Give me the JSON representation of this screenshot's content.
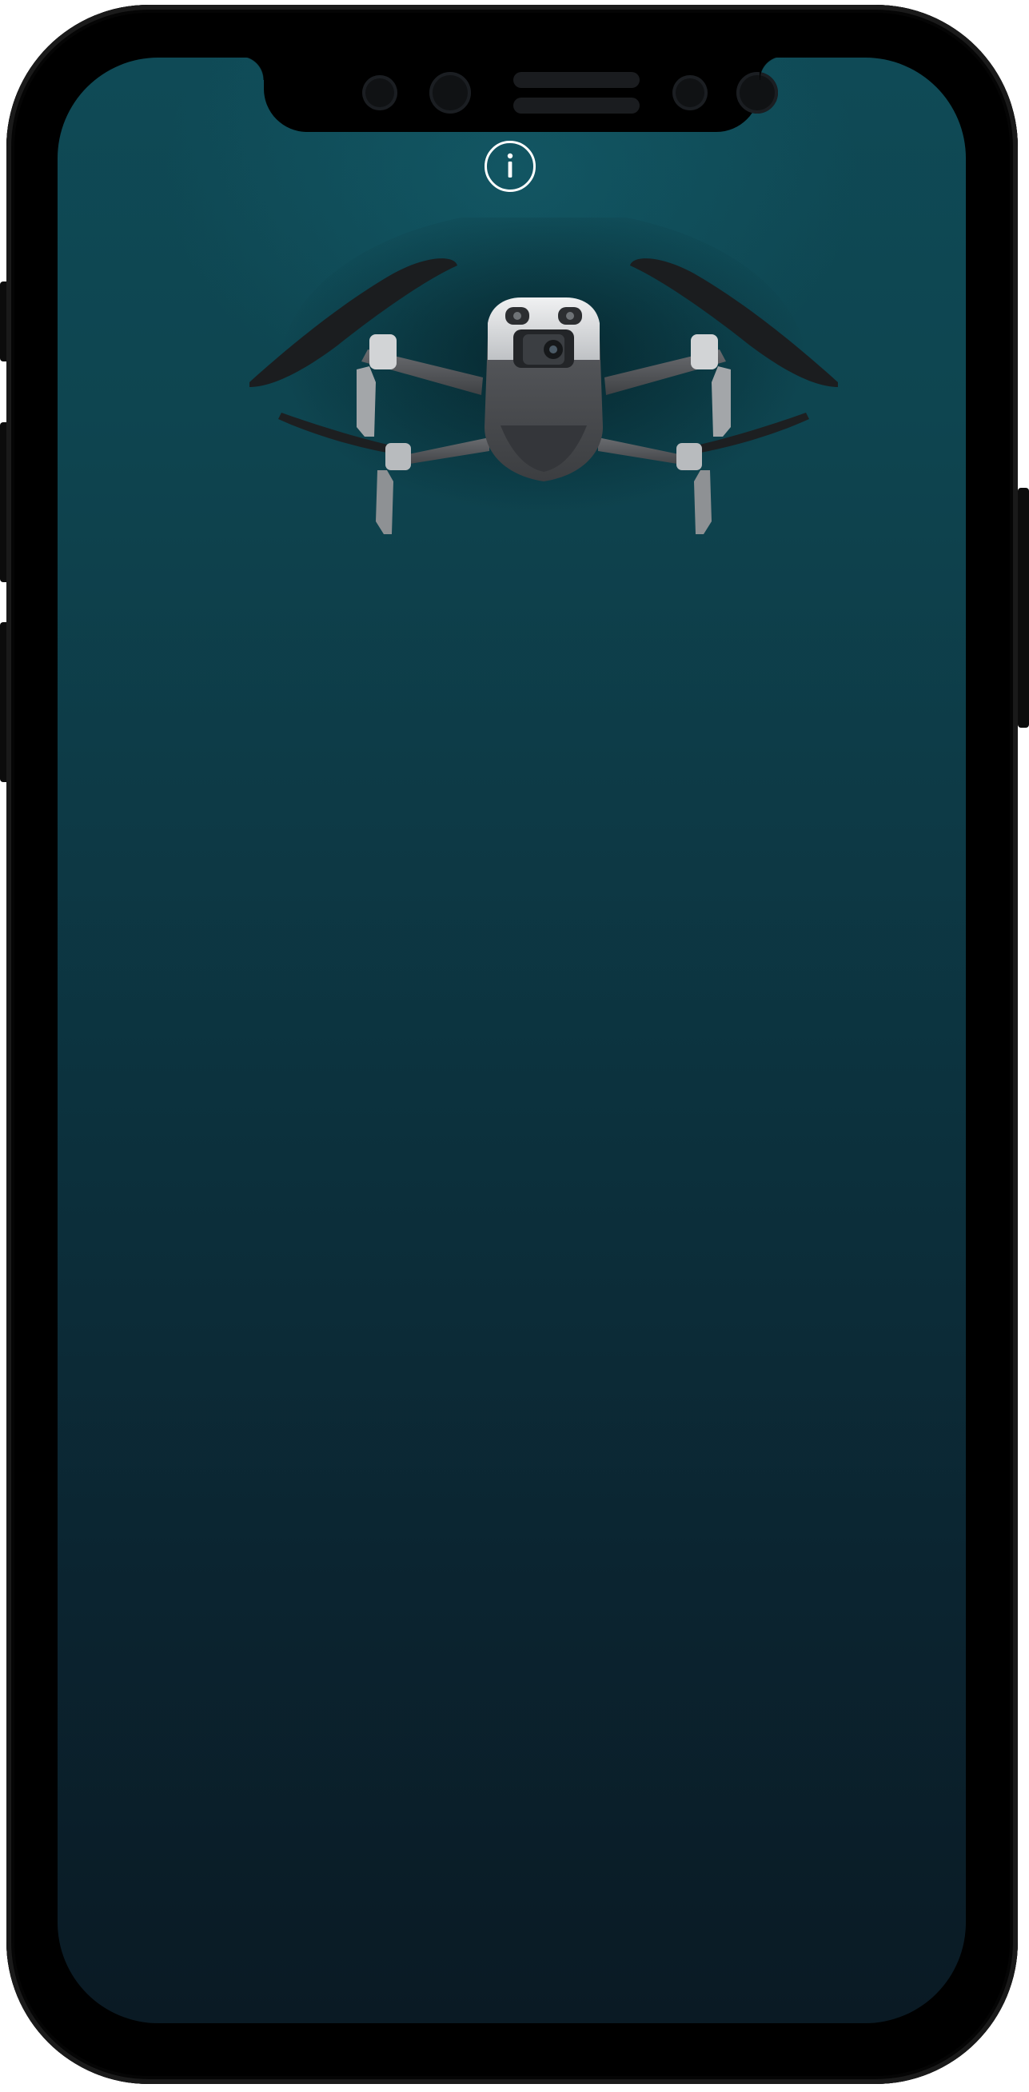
{
  "device": {
    "model": "phone-with-notch",
    "frame_color": "#000000",
    "screen_gradient_top": "#0f4a56",
    "screen_gradient_bottom": "#0a1a24"
  },
  "screen": {
    "info_button": {
      "icon": "info-icon",
      "color": "#ffffff"
    },
    "hero_image": {
      "subject": "drone-illustration",
      "body_color": "#4a4c4f",
      "front_color": "#d9dbdd"
    }
  }
}
